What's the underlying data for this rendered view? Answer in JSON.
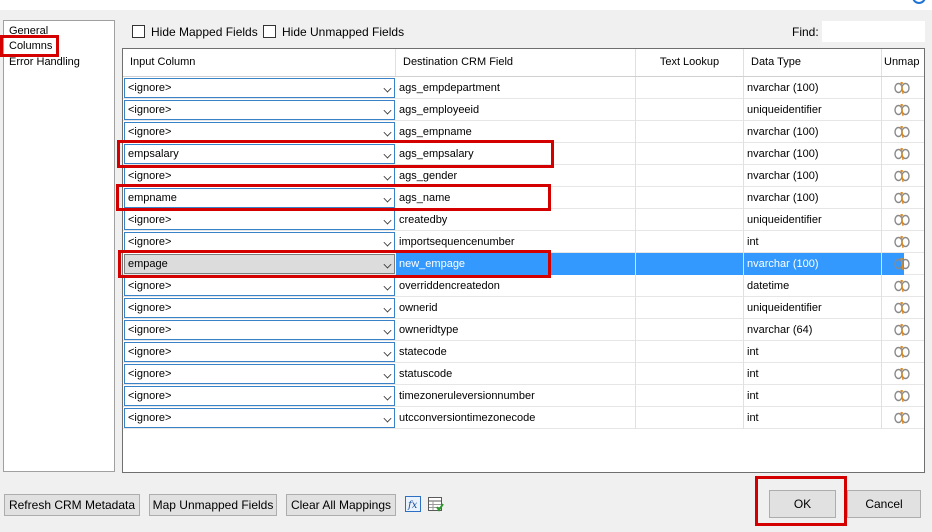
{
  "nav": {
    "items": [
      "General",
      "Columns",
      "Error Handling"
    ]
  },
  "toolbar": {
    "hide_mapped": "Hide Mapped Fields",
    "hide_unmapped": "Hide Unmapped Fields",
    "find_label": "Find:",
    "find_value": ""
  },
  "grid": {
    "headers": {
      "input": "Input Column",
      "dest": "Destination CRM Field",
      "lookup": "Text Lookup",
      "type": "Data Type",
      "unmap": "Unmap"
    },
    "rows": [
      {
        "input": "<ignore>",
        "dest": "ags_empdepartment",
        "lookup": "",
        "type": "nvarchar (100)"
      },
      {
        "input": "<ignore>",
        "dest": "ags_employeeid",
        "lookup": "",
        "type": "uniqueidentifier"
      },
      {
        "input": "<ignore>",
        "dest": "ags_empname",
        "lookup": "",
        "type": "nvarchar (100)"
      },
      {
        "input": "empsalary",
        "dest": "ags_empsalary",
        "lookup": "",
        "type": "nvarchar (100)"
      },
      {
        "input": "<ignore>",
        "dest": "ags_gender",
        "lookup": "",
        "type": "nvarchar (100)"
      },
      {
        "input": "empname",
        "dest": "ags_name",
        "lookup": "",
        "type": "nvarchar (100)"
      },
      {
        "input": "<ignore>",
        "dest": "createdby",
        "lookup": "",
        "type": "uniqueidentifier"
      },
      {
        "input": "<ignore>",
        "dest": "importsequencenumber",
        "lookup": "",
        "type": "int"
      },
      {
        "input": "empage",
        "dest": "new_empage",
        "lookup": "",
        "type": "nvarchar (100)"
      },
      {
        "input": "<ignore>",
        "dest": "overriddencreatedon",
        "lookup": "",
        "type": "datetime"
      },
      {
        "input": "<ignore>",
        "dest": "ownerid",
        "lookup": "",
        "type": "uniqueidentifier"
      },
      {
        "input": "<ignore>",
        "dest": "owneridtype",
        "lookup": "",
        "type": "nvarchar (64)"
      },
      {
        "input": "<ignore>",
        "dest": "statecode",
        "lookup": "",
        "type": "int"
      },
      {
        "input": "<ignore>",
        "dest": "statuscode",
        "lookup": "",
        "type": "int"
      },
      {
        "input": "<ignore>",
        "dest": "timezoneruleversionnumber",
        "lookup": "",
        "type": "int"
      },
      {
        "input": "<ignore>",
        "dest": "utcconversiontimezonecode",
        "lookup": "",
        "type": "int"
      }
    ]
  },
  "buttons": {
    "refresh": "Refresh CRM Metadata",
    "map_unmapped": "Map Unmapped Fields",
    "clear_all": "Clear All Mappings",
    "ok": "OK",
    "cancel": "Cancel"
  },
  "icons": {
    "function": "fx-function-icon",
    "spreadsheet": "spreadsheet-icon",
    "unmap": "unmap-icon"
  },
  "colors": {
    "selection": "#3399ff",
    "highlight": "#d40000"
  }
}
